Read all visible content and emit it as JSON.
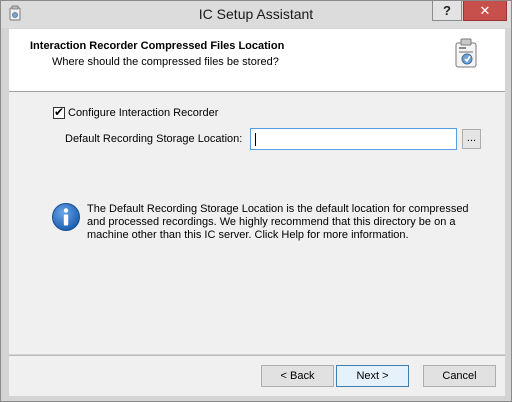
{
  "window": {
    "title": "IC Setup Assistant",
    "help_label": "?",
    "close_label": "✕"
  },
  "header": {
    "title": "Interaction Recorder Compressed Files Location",
    "subtitle": "Where should the compressed files be stored?"
  },
  "form": {
    "configure_checkbox_label": "Configure Interaction Recorder",
    "configure_checked": true,
    "check_mark": "✔",
    "storage_label": "Default Recording Storage Location:",
    "storage_value": "",
    "browse_label": "..."
  },
  "info": {
    "text": "The Default Recording Storage Location is the default location for compressed and processed recordings. We highly recommend that this directory be on a machine other than this IC server. Click Help for more information."
  },
  "buttons": {
    "back": "< Back",
    "next": "Next >",
    "cancel": "Cancel"
  },
  "colors": {
    "close_button": "#c7504c",
    "input_focus_border": "#569de5",
    "info_icon": "#1c5fb0"
  }
}
